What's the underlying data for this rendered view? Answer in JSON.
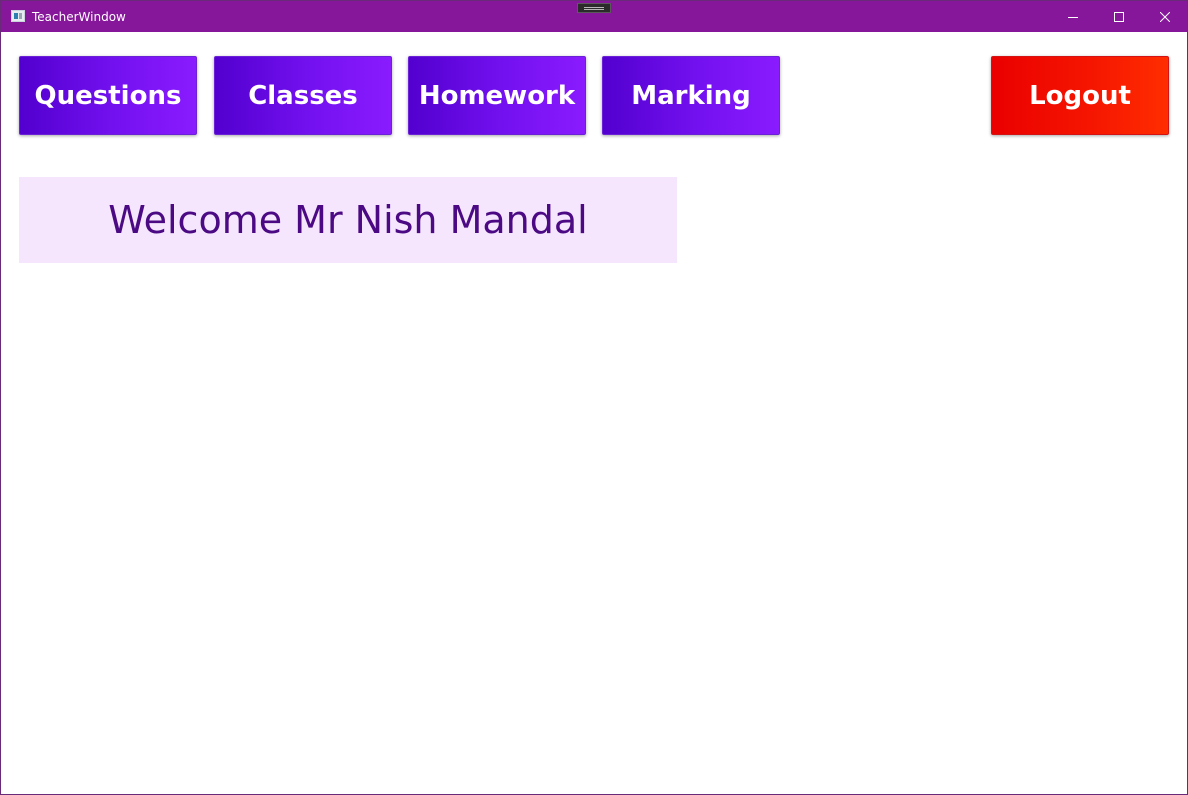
{
  "window": {
    "title": "TeacherWindow",
    "title_bar_color": "#86179a",
    "icons": {
      "app": "app-window-icon",
      "minimize": "minimize-icon",
      "maximize": "maximize-icon",
      "close": "close-icon"
    }
  },
  "nav": {
    "questions_label": "Questions",
    "classes_label": "Classes",
    "homework_label": "Homework",
    "marking_label": "Marking",
    "logout_label": "Logout"
  },
  "colors": {
    "nav_button": "#6a0ae6",
    "logout_button": "#f51500",
    "welcome_background": "#f5e6fd",
    "welcome_text": "#4b0a84"
  },
  "welcome": {
    "text": "Welcome Mr Nish Mandal"
  }
}
